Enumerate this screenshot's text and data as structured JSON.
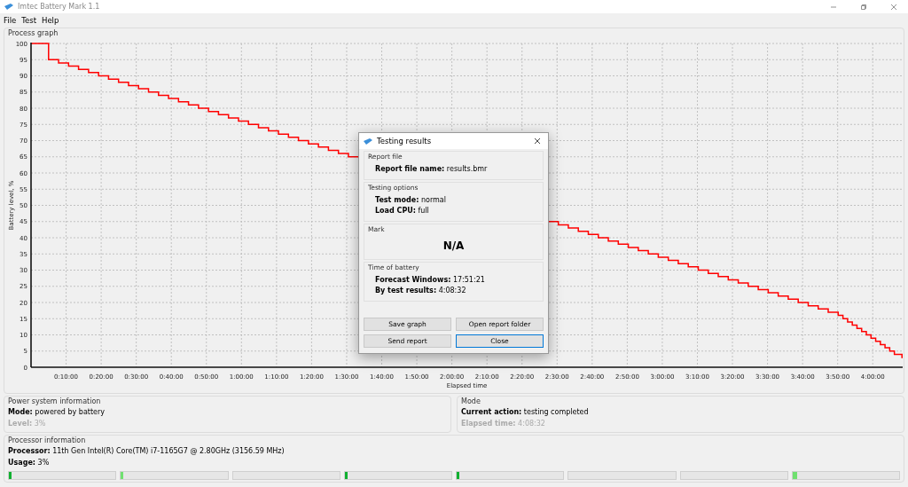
{
  "window": {
    "title": "Imtec Battery Mark 1.1"
  },
  "menu": [
    "File",
    "Test",
    "Help"
  ],
  "process_graph": {
    "title": "Process graph",
    "chart_data": {
      "type": "line",
      "grid": true,
      "xlabel": "Elapsed time",
      "ylabel": "Battery level, %",
      "xlim": [
        0,
        14912
      ],
      "ylim": [
        0,
        100
      ],
      "yticks": [
        0,
        5,
        10,
        15,
        20,
        25,
        30,
        35,
        40,
        45,
        50,
        55,
        60,
        65,
        70,
        75,
        80,
        85,
        90,
        95,
        100
      ],
      "xticks": [
        {
          "value": 600,
          "label": "0:10:00"
        },
        {
          "value": 1200,
          "label": "0:20:00"
        },
        {
          "value": 1800,
          "label": "0:30:00"
        },
        {
          "value": 2400,
          "label": "0:40:00"
        },
        {
          "value": 3000,
          "label": "0:50:00"
        },
        {
          "value": 3600,
          "label": "1:00:00"
        },
        {
          "value": 4200,
          "label": "1:10:00"
        },
        {
          "value": 4800,
          "label": "1:20:00"
        },
        {
          "value": 5400,
          "label": "1:30:00"
        },
        {
          "value": 6000,
          "label": "1:40:00"
        },
        {
          "value": 6600,
          "label": "1:50:00"
        },
        {
          "value": 7200,
          "label": "2:00:00"
        },
        {
          "value": 7800,
          "label": "2:10:00"
        },
        {
          "value": 8400,
          "label": "2:20:00"
        },
        {
          "value": 9000,
          "label": "2:30:00"
        },
        {
          "value": 9600,
          "label": "2:40:00"
        },
        {
          "value": 10200,
          "label": "2:50:00"
        },
        {
          "value": 10800,
          "label": "3:00:00"
        },
        {
          "value": 11400,
          "label": "3:10:00"
        },
        {
          "value": 12000,
          "label": "3:20:00"
        },
        {
          "value": 12600,
          "label": "3:30:00"
        },
        {
          "value": 13200,
          "label": "3:40:00"
        },
        {
          "value": 13800,
          "label": "3:50:00"
        },
        {
          "value": 14400,
          "label": "4:00:00"
        }
      ],
      "x": [
        0,
        300,
        300,
        471,
        471,
        642,
        642,
        813,
        813,
        984,
        984,
        1155,
        1155,
        1326,
        1326,
        1497,
        1497,
        1668,
        1668,
        1839,
        1839,
        2010,
        2010,
        2181,
        2181,
        2352,
        2352,
        2523,
        2523,
        2694,
        2694,
        2865,
        2865,
        3036,
        3036,
        3207,
        3207,
        3378,
        3378,
        3549,
        3549,
        3720,
        3720,
        3891,
        3891,
        4062,
        4062,
        4233,
        4233,
        4404,
        4404,
        4575,
        4575,
        4746,
        4746,
        4917,
        4917,
        5088,
        5088,
        5259,
        5259,
        5430,
        5430,
        5601,
        7000,
        8850,
        9021,
        9021,
        9192,
        9192,
        9363,
        9363,
        9534,
        9534,
        9705,
        9705,
        9876,
        9876,
        10047,
        10047,
        10218,
        10218,
        10389,
        10389,
        10560,
        10560,
        10731,
        10731,
        10902,
        10902,
        11073,
        11073,
        11244,
        11244,
        11415,
        11415,
        11586,
        11586,
        11757,
        11757,
        11928,
        11928,
        12099,
        12099,
        12270,
        12270,
        12441,
        12441,
        12612,
        12612,
        12783,
        12783,
        12954,
        12954,
        13125,
        13125,
        13296,
        13296,
        13467,
        13467,
        13638,
        13638,
        13809,
        13809,
        13890,
        13890,
        13970,
        13970,
        14050,
        14050,
        14130,
        14130,
        14210,
        14210,
        14290,
        14290,
        14370,
        14370,
        14450,
        14450,
        14530,
        14530,
        14610,
        14610,
        14690,
        14690,
        14770,
        14770,
        14900,
        14900,
        14912
      ],
      "series": [
        {
          "color": "#ff0000",
          "values": [
            100,
            100,
            95,
            95,
            94,
            94,
            93,
            93,
            92,
            92,
            91,
            91,
            90,
            90,
            89,
            89,
            88,
            88,
            87,
            87,
            86,
            86,
            85,
            85,
            84,
            84,
            83,
            83,
            82,
            82,
            81,
            81,
            80,
            80,
            79,
            79,
            78,
            78,
            77,
            77,
            76,
            76,
            75,
            75,
            74,
            74,
            73,
            73,
            72,
            72,
            71,
            71,
            70,
            70,
            69,
            69,
            68,
            68,
            67,
            67,
            66,
            66,
            65,
            65,
            null,
            45,
            45,
            44,
            44,
            43,
            43,
            42,
            42,
            41,
            41,
            40,
            40,
            39,
            39,
            38,
            38,
            37,
            37,
            36,
            36,
            35,
            35,
            34,
            34,
            33,
            33,
            32,
            32,
            31,
            31,
            30,
            30,
            29,
            29,
            28,
            28,
            27,
            27,
            26,
            26,
            25,
            25,
            24,
            24,
            23,
            23,
            22,
            22,
            21,
            21,
            20,
            20,
            19,
            19,
            18,
            18,
            17,
            17,
            16,
            16,
            15,
            15,
            14,
            14,
            13,
            13,
            12,
            12,
            11,
            11,
            10,
            10,
            9,
            9,
            8,
            8,
            7,
            7,
            6,
            6,
            5,
            5,
            4,
            4,
            3,
            3
          ]
        }
      ]
    }
  },
  "power": {
    "title": "Power system information",
    "fields": [
      {
        "label": "Mode:",
        "value": "powered by battery",
        "disabled": false
      },
      {
        "label": "Level:",
        "value": "3%",
        "disabled": true
      }
    ]
  },
  "mode": {
    "title": "Mode",
    "fields": [
      {
        "label": "Current action:",
        "value": "testing completed",
        "disabled": false
      },
      {
        "label": "Elapsed time:",
        "value": "4:08:32",
        "disabled": true
      }
    ]
  },
  "processor": {
    "title": "Processor information",
    "fields": [
      {
        "label": "Processor:",
        "value": "11th Gen Intel(R) Core(TM) i7-1165G7 @ 2.80GHz  (3156.59 MHz)"
      },
      {
        "label": "Usage:",
        "value": "3%"
      }
    ],
    "cores": [
      {
        "level": 0.01,
        "color": "#10b030"
      },
      {
        "level": 0.02,
        "color": "#70e070"
      },
      {
        "level": 0
      },
      {
        "level": 0.02,
        "color": "#10b030"
      },
      {
        "level": 0.02,
        "color": "#10b030"
      },
      {
        "level": 0
      },
      {
        "level": 0
      },
      {
        "level": 0.04,
        "color": "#70e070"
      }
    ]
  },
  "dialog": {
    "title": "Testing results",
    "sections": [
      {
        "title": "Report file",
        "kind": "fields",
        "fields": [
          {
            "label": "Report file name:",
            "value": "results.bmr"
          }
        ]
      },
      {
        "title": "Testing options",
        "kind": "fields",
        "fields": [
          {
            "label": "Test mode:",
            "value": "normal"
          },
          {
            "label": "Load CPU:",
            "value": "full"
          }
        ]
      },
      {
        "title": "Mark",
        "kind": "mark",
        "value": "N/A"
      },
      {
        "title": "Time of battery",
        "kind": "fields",
        "fields": [
          {
            "label": "Forecast Windows:",
            "value": "17:51:21"
          },
          {
            "label": "By test results:",
            "value": "4:08:32"
          }
        ]
      }
    ],
    "buttons": [
      {
        "label": "Save graph",
        "focused": false
      },
      {
        "label": "Open report folder",
        "focused": false
      },
      {
        "label": "Send report",
        "focused": false
      },
      {
        "label": "Close",
        "focused": true
      }
    ]
  }
}
